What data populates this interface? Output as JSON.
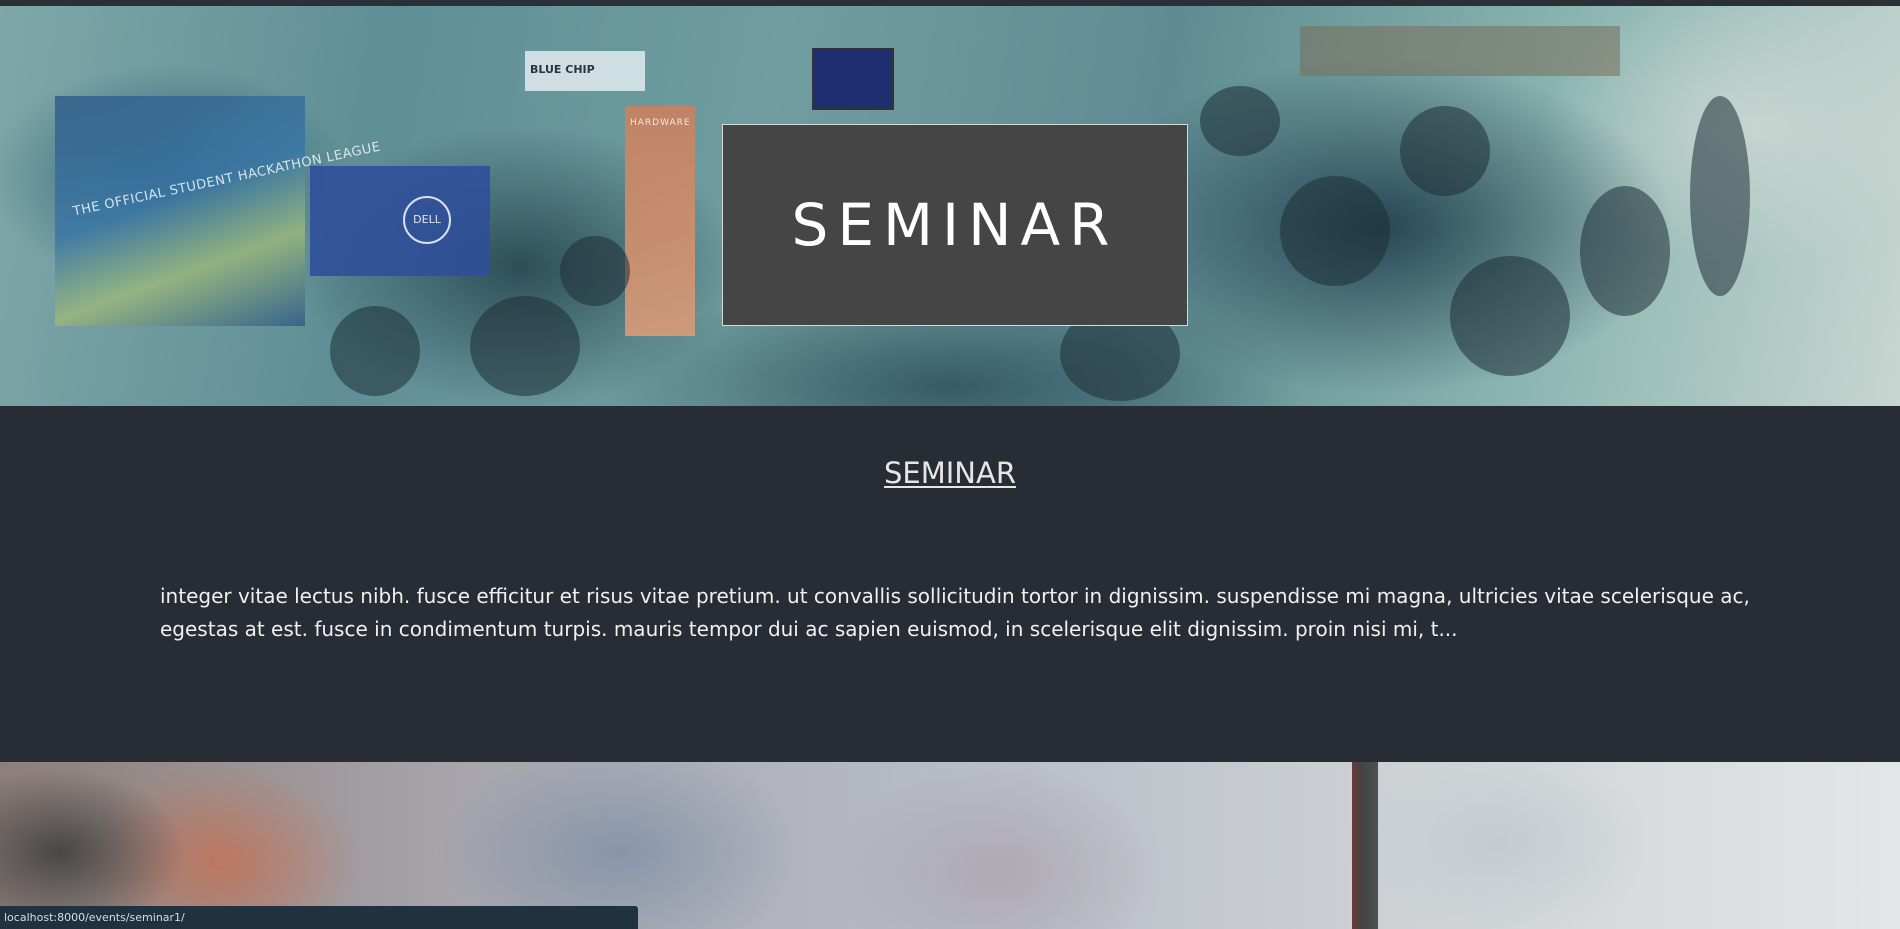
{
  "hero": {
    "title": "SEMINAR",
    "scene": {
      "banner_left_text": "THE OFFICIAL STUDENT HACKATHON LEAGUE",
      "sign_text": "BLUE CHIP",
      "hardware_banner": "HARDWARE",
      "table_logo": "DELL"
    }
  },
  "event": {
    "heading": "SEMINAR",
    "description": "integer vitae lectus nibh. fusce efficitur et risus vitae pretium. ut convallis sollicitudin tortor in dignissim. suspendisse mi magna, ultricies vitae scelerisque ac, egestas at est. fusce in condimentum turpis. mauris tempor dui ac sapien euismod, in scelerisque elit dignissim. proin nisi mi, t..."
  },
  "status_bar": {
    "url": "localhost:8000/events/seminar1/"
  },
  "colors": {
    "content_background": "#282c34",
    "title_box": "#454545",
    "status_bar": "#20323f"
  }
}
